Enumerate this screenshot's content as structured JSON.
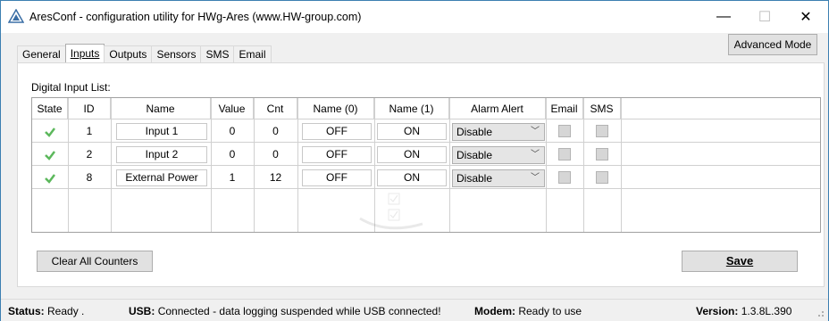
{
  "window": {
    "title": "AresConf - configuration utility for HWg-Ares (www.HW-group.com)",
    "controls": {
      "minimize": "—",
      "maximize": "☐",
      "close": "✕"
    }
  },
  "tabs": [
    "General",
    "Inputs",
    "Outputs",
    "Sensors",
    "SMS",
    "Email"
  ],
  "active_tab": "Inputs",
  "advanced_mode_label": "Advanced Mode",
  "list_label": "Digital Input List:",
  "columns": [
    "State",
    "ID",
    "Name",
    "Value",
    "Cnt",
    "Name (0)",
    "Name (1)",
    "Alarm Alert",
    "Email",
    "SMS"
  ],
  "rows": [
    {
      "state": "ok",
      "id": "1",
      "name": "Input 1",
      "value": "0",
      "cnt": "0",
      "name0": "OFF",
      "name1": "ON",
      "alarm": "Disable",
      "email": false,
      "sms": false
    },
    {
      "state": "ok",
      "id": "2",
      "name": "Input 2",
      "value": "0",
      "cnt": "0",
      "name0": "OFF",
      "name1": "ON",
      "alarm": "Disable",
      "email": false,
      "sms": false
    },
    {
      "state": "ok",
      "id": "8",
      "name": "External Power",
      "value": "1",
      "cnt": "12",
      "name0": "OFF",
      "name1": "ON",
      "alarm": "Disable",
      "email": false,
      "sms": false
    }
  ],
  "buttons": {
    "clear": "Clear All Counters",
    "save": "Save"
  },
  "status": {
    "status_label": "Status:",
    "status_value": "Ready .",
    "usb_label": "USB:",
    "usb_value": "Connected - data logging suspended while USB connected!",
    "modem_label": "Modem:",
    "modem_value": "Ready to use",
    "version_label": "Version:",
    "version_value": "1.3.8L.390"
  },
  "colors": {
    "check_green": "#5cb85c",
    "window_border": "#3c7fb1"
  }
}
